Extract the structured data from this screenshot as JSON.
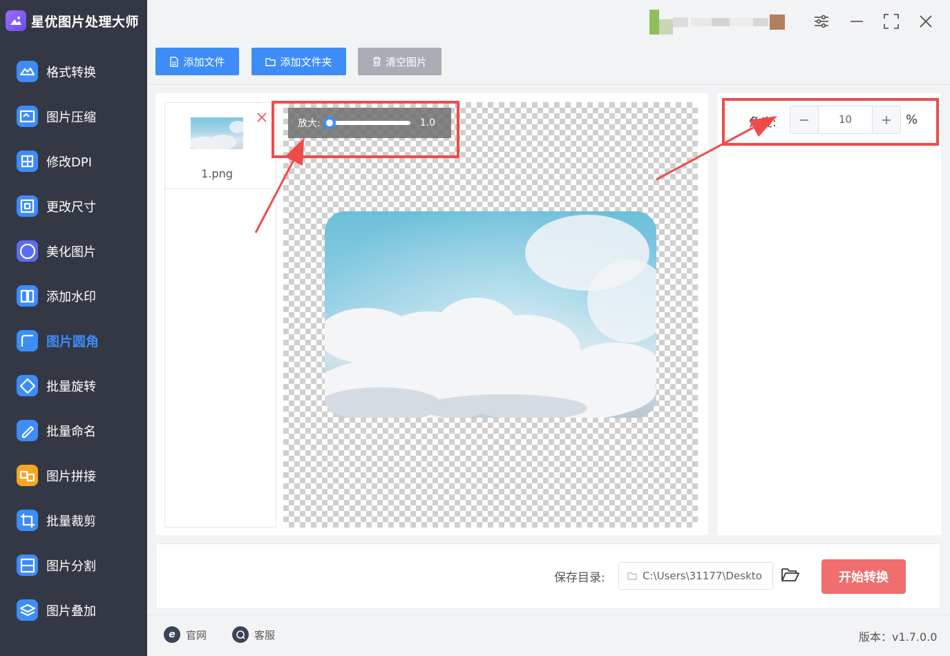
{
  "app": {
    "title": "星优图片处理大师"
  },
  "sidebar": {
    "items": [
      {
        "label": "格式转换",
        "icon": "format-convert-icon",
        "color": "#3d8cf7"
      },
      {
        "label": "图片压缩",
        "icon": "compress-icon",
        "color": "#3d8cf7"
      },
      {
        "label": "修改DPI",
        "icon": "dpi-icon",
        "color": "#3d8cf7"
      },
      {
        "label": "更改尺寸",
        "icon": "resize-icon",
        "color": "#3d8cf7"
      },
      {
        "label": "美化图片",
        "icon": "beautify-icon",
        "color": "#5b6cf0"
      },
      {
        "label": "添加水印",
        "icon": "watermark-icon",
        "color": "#3d8cf7"
      },
      {
        "label": "图片圆角",
        "icon": "rounded-corner-icon",
        "color": "#3d8cf7",
        "active": true
      },
      {
        "label": "批量旋转",
        "icon": "rotate-icon",
        "color": "#3d8cf7"
      },
      {
        "label": "批量命名",
        "icon": "rename-icon",
        "color": "#3d8cf7"
      },
      {
        "label": "图片拼接",
        "icon": "stitch-icon",
        "color": "#f5a623"
      },
      {
        "label": "批量裁剪",
        "icon": "crop-icon",
        "color": "#3d8cf7"
      },
      {
        "label": "图片分割",
        "icon": "split-icon",
        "color": "#3d8cf7"
      },
      {
        "label": "图片叠加",
        "icon": "overlay-icon",
        "color": "#3d8cf7"
      }
    ]
  },
  "toolbar": {
    "add_file": "添加文件",
    "add_folder": "添加文件夹",
    "clear": "清空图片"
  },
  "files": [
    {
      "name": "1.png"
    }
  ],
  "zoom": {
    "label": "放大:",
    "value": "1.0",
    "level": 0
  },
  "angle": {
    "label": "角度:",
    "value": "10",
    "unit": "%"
  },
  "output": {
    "label": "保存目录:",
    "path": "C:\\Users\\31177\\Deskto"
  },
  "start_button": "开始转换",
  "footer": {
    "website": "官网",
    "support": "客服",
    "version": "版本：v1.7.0.0"
  },
  "colors": {
    "accent": "#3d8cf7",
    "sidebar_bg": "#343844",
    "start": "#f06e6e",
    "highlight": "#ef4b4b",
    "clear_btn": "#a9aeb6"
  }
}
